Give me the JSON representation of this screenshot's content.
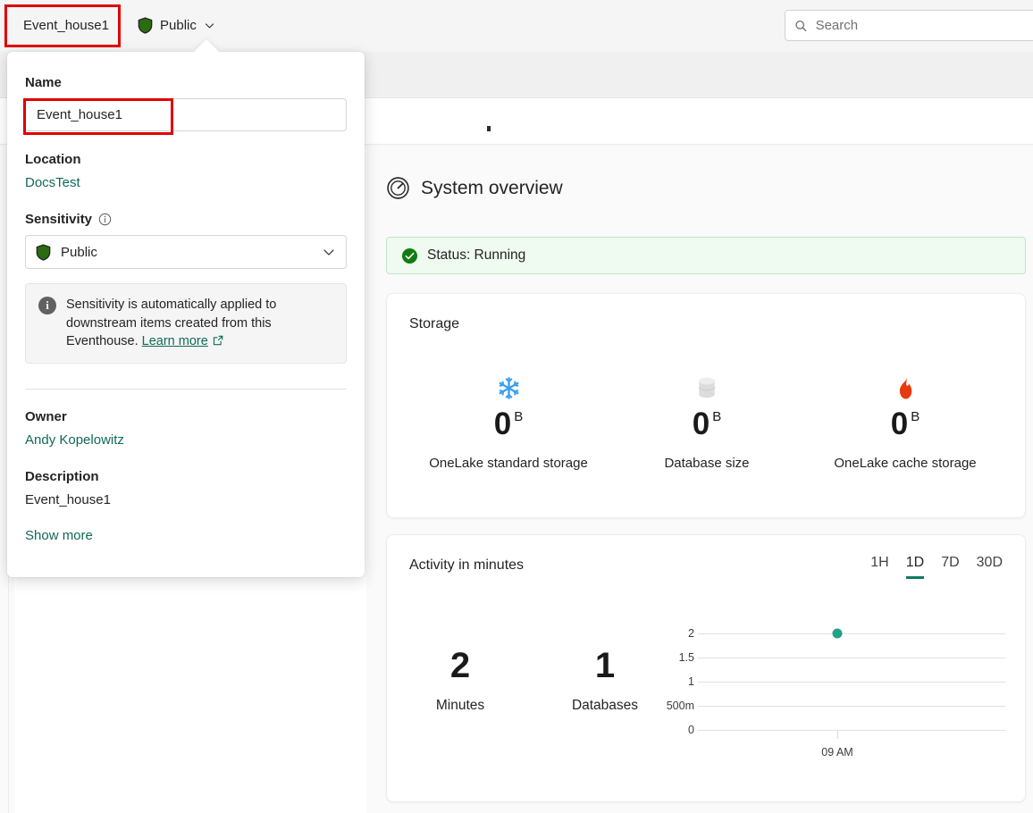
{
  "topbar": {
    "breadcrumb_label": "Event_house1",
    "sensitivity_label": "Public",
    "search_placeholder": "Search",
    "search_value": ""
  },
  "flyout": {
    "name_label": "Name",
    "name_value": "Event_house1",
    "location_label": "Location",
    "location_value": "DocsTest",
    "sensitivity_label": "Sensitivity",
    "sensitivity_value": "Public",
    "info_text_before": "Sensitivity is automatically applied to downstream items created from this Eventhouse.",
    "info_link": "Learn more",
    "owner_label": "Owner",
    "owner_value": "Andy Kopelowitz",
    "description_label": "Description",
    "description_value": "Event_house1",
    "show_more_label": "Show more"
  },
  "system_overview": {
    "title": "System overview",
    "status_text": "Status: Running"
  },
  "storage": {
    "title": "Storage",
    "metrics": [
      {
        "icon": "snowflake-icon",
        "value": "0",
        "unit": "B",
        "label": "OneLake standard storage",
        "color": "#3aa0ef"
      },
      {
        "icon": "database-icon",
        "value": "0",
        "unit": "B",
        "label": "Database size",
        "color": "#d9d9d9"
      },
      {
        "icon": "flame-icon",
        "value": "0",
        "unit": "B",
        "label": "OneLake cache storage",
        "color": "#e8380d"
      }
    ]
  },
  "activity": {
    "title": "Activity in minutes",
    "ranges": [
      "1H",
      "1D",
      "7D",
      "30D"
    ],
    "selected_range": "1D",
    "stats": [
      {
        "value": "2",
        "label": "Minutes"
      },
      {
        "value": "1",
        "label": "Databases"
      }
    ]
  },
  "colors": {
    "accent_teal": "#0f7b63",
    "link_green": "#0f6b57",
    "status_green": "#107c10",
    "annotation_red": "#e00000",
    "series_teal": "#21a187"
  },
  "chart_data": {
    "type": "scatter",
    "title": "Activity in minutes",
    "xlabel": "",
    "ylabel": "",
    "x": [
      "09 AM"
    ],
    "values": [
      2
    ],
    "xtick_labels": [
      "09 AM"
    ],
    "ytick_labels": [
      "0",
      "500m",
      "1",
      "1.5",
      "2"
    ],
    "ytick_values": [
      0,
      0.5,
      1,
      1.5,
      2
    ],
    "ylim": [
      0,
      2
    ],
    "grid": true,
    "legend": "none",
    "series": [
      {
        "name": "Activity in minutes",
        "values": [
          2
        ],
        "color": "#21a187"
      }
    ]
  }
}
